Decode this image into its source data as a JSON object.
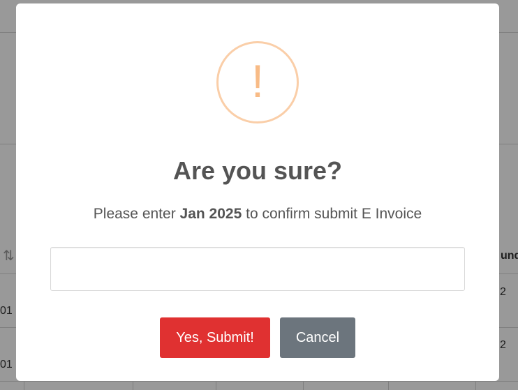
{
  "background": {
    "sort_icon": "sort-arrows-icon",
    "row_cells": [
      {
        "text": "01"
      },
      {
        "text": "01"
      },
      {
        "text": "2"
      },
      {
        "text": "2"
      },
      {
        "text": "und"
      }
    ]
  },
  "modal": {
    "icon": "exclamation-icon",
    "icon_glyph": "!",
    "title": "Are you sure?",
    "message": {
      "prefix": "Please enter ",
      "highlight": "Jan 2025",
      "suffix": " to confirm submit E Invoice"
    },
    "input": {
      "value": "",
      "placeholder": ""
    },
    "confirm_button": "Yes, Submit!",
    "cancel_button": "Cancel"
  },
  "colors": {
    "overlay": "rgba(0,0,0,0.4)",
    "warning_border": "#facea8",
    "warning_mark": "#f8bb86",
    "title_text": "#545454",
    "confirm_button": "#e03131",
    "cancel_button": "#6c757d"
  }
}
